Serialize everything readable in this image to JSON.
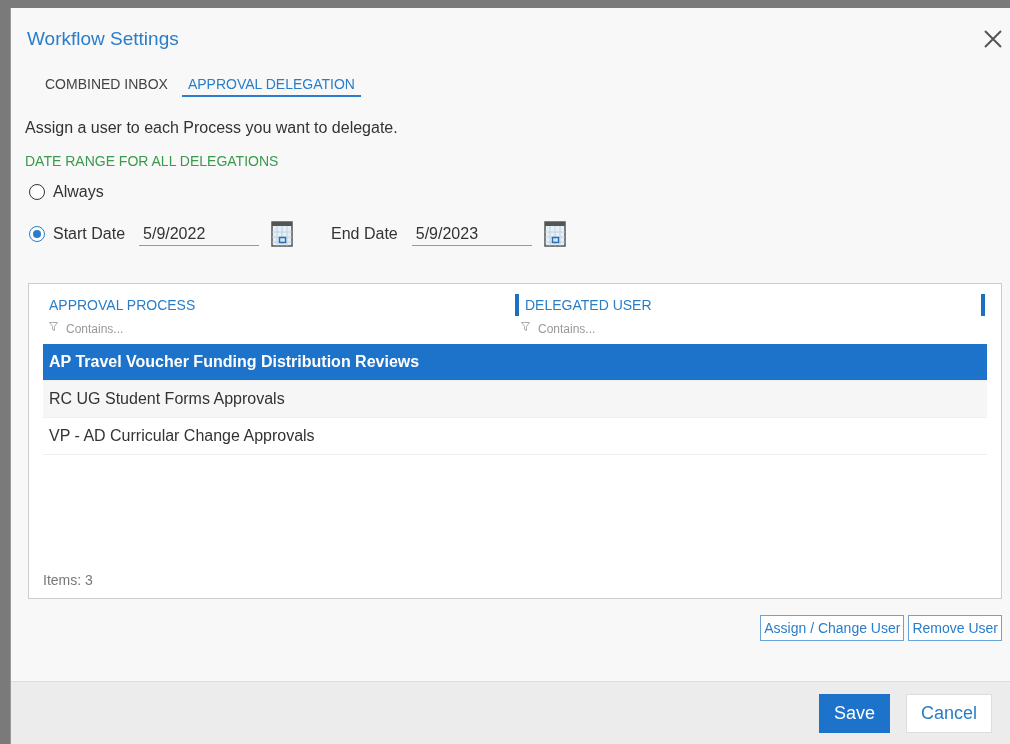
{
  "dialog": {
    "title": "Workflow Settings"
  },
  "tabs": [
    {
      "label": "COMBINED INBOX",
      "selected": false
    },
    {
      "label": "APPROVAL DELEGATION",
      "selected": true
    }
  ],
  "instructions": "Assign a user to each Process you want to delegate.",
  "date_range": {
    "heading": "DATE RANGE FOR ALL DELEGATIONS",
    "options": [
      {
        "label": "Always",
        "selected": false
      },
      {
        "label": "Start Date",
        "selected": true
      }
    ],
    "start_date": "5/9/2022",
    "end_label": "End Date",
    "end_date": "5/9/2023"
  },
  "table": {
    "columns": [
      {
        "label": "APPROVAL PROCESS",
        "filter_placeholder": "Contains..."
      },
      {
        "label": "DELEGATED USER",
        "filter_placeholder": "Contains..."
      }
    ],
    "rows": [
      {
        "process": "AP Travel Voucher Funding Distribution Reviews",
        "selected": true
      },
      {
        "process": "RC UG Student Forms Approvals",
        "selected": false
      },
      {
        "process": "VP - AD Curricular Change Approvals",
        "selected": false
      }
    ],
    "item_count": "Items: 3"
  },
  "actions": [
    "Assign / Change User",
    "Remove User"
  ],
  "footer_buttons": [
    {
      "label": "Save",
      "kind": "primary"
    },
    {
      "label": "Cancel",
      "kind": "secondary"
    }
  ]
}
